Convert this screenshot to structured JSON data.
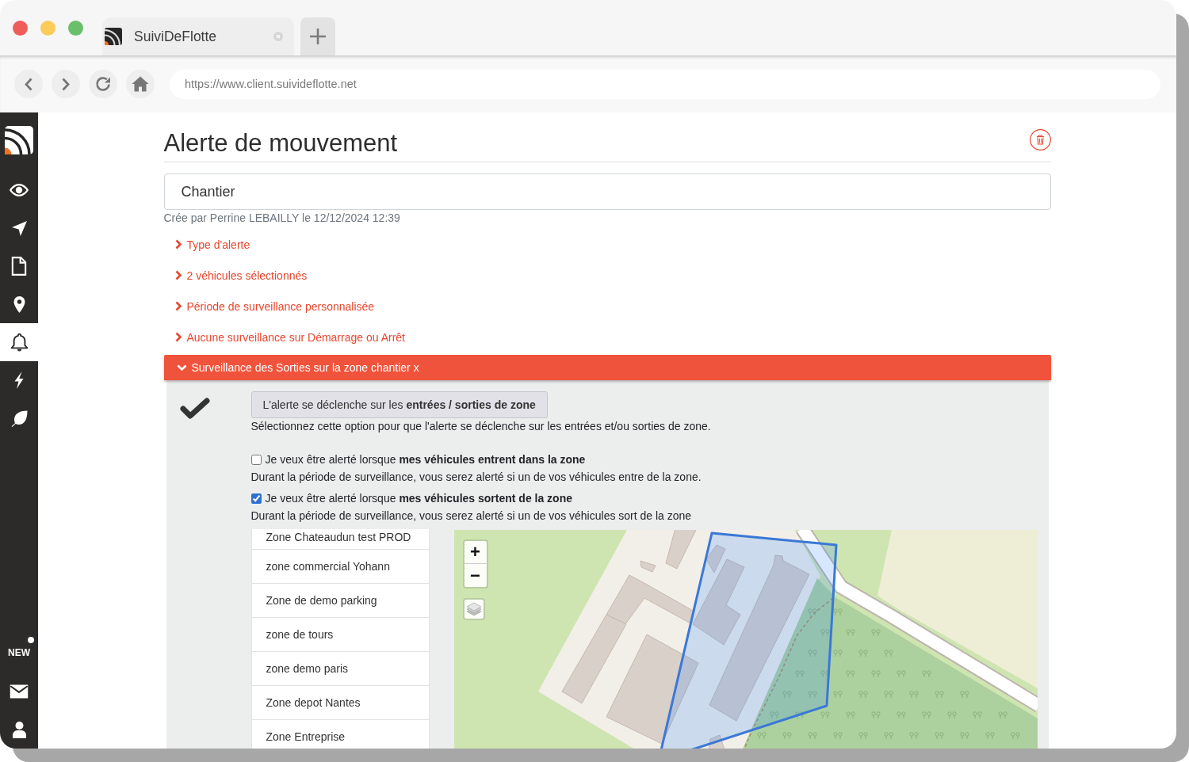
{
  "browser": {
    "tab_title": "SuiviDeFlotte",
    "address": "https://www.client.suivideflotte.net"
  },
  "sidebar": {
    "items": [
      {
        "selected": false
      },
      {
        "selected": false
      },
      {
        "selected": false
      },
      {
        "selected": false
      },
      {
        "selected": true
      },
      {
        "selected": false
      },
      {
        "selected": false
      }
    ],
    "new_label": "NEW",
    "new_unread": true
  },
  "page": {
    "title": "Alerte de mouvement",
    "name_value": "Chantier",
    "created_by": "Crée par Perrine LEBAILLY le 12/12/2024 12:39",
    "sections": [
      {
        "label": "Type d'alerte",
        "expanded": false
      },
      {
        "label": "2 véhicules sélectionnés",
        "expanded": false
      },
      {
        "label": "Période de surveillance personnalisée",
        "expanded": false
      },
      {
        "label": "Aucune surveillance sur Démarrage ou Arrêt",
        "expanded": false
      },
      {
        "label": "Surveillance des Sorties sur la zone chantier x",
        "expanded": true
      }
    ],
    "zone_trigger": {
      "selected": true,
      "button": "L'alerte se déclenche sur les **entrées / sorties de zone**",
      "help": "Sélectionnez cette option pour que l'alerte se déclenche sur les entrées et/ou sorties de zone.",
      "options": [
        {
          "label": "Je veux être alerté lorsque **mes véhicules entrent dans la zone**",
          "checked": false,
          "help": "Durant la période de surveillance, vous serez alerté si un de vos véhicules entre de la zone."
        },
        {
          "label": "Je veux être alerté lorsque **mes véhicules sortent de la zone**",
          "checked": true,
          "help": "Durant la période de surveillance, vous serez alerté si un de vos véhicules sort de la zone"
        }
      ],
      "zones": [
        {
          "name": "Zone Chateaudun test PROD",
          "selected": false
        },
        {
          "name": "zone commercial Yohann",
          "selected": false
        },
        {
          "name": "Zone de demo parking",
          "selected": false
        },
        {
          "name": "zone de tours",
          "selected": false
        },
        {
          "name": "zone demo paris",
          "selected": false
        },
        {
          "name": "Zone depot Nantes",
          "selected": false
        },
        {
          "name": "Zone Entreprise",
          "selected": false
        }
      ],
      "map": {
        "zoom_in": "+",
        "zoom_out": "−"
      }
    }
  }
}
